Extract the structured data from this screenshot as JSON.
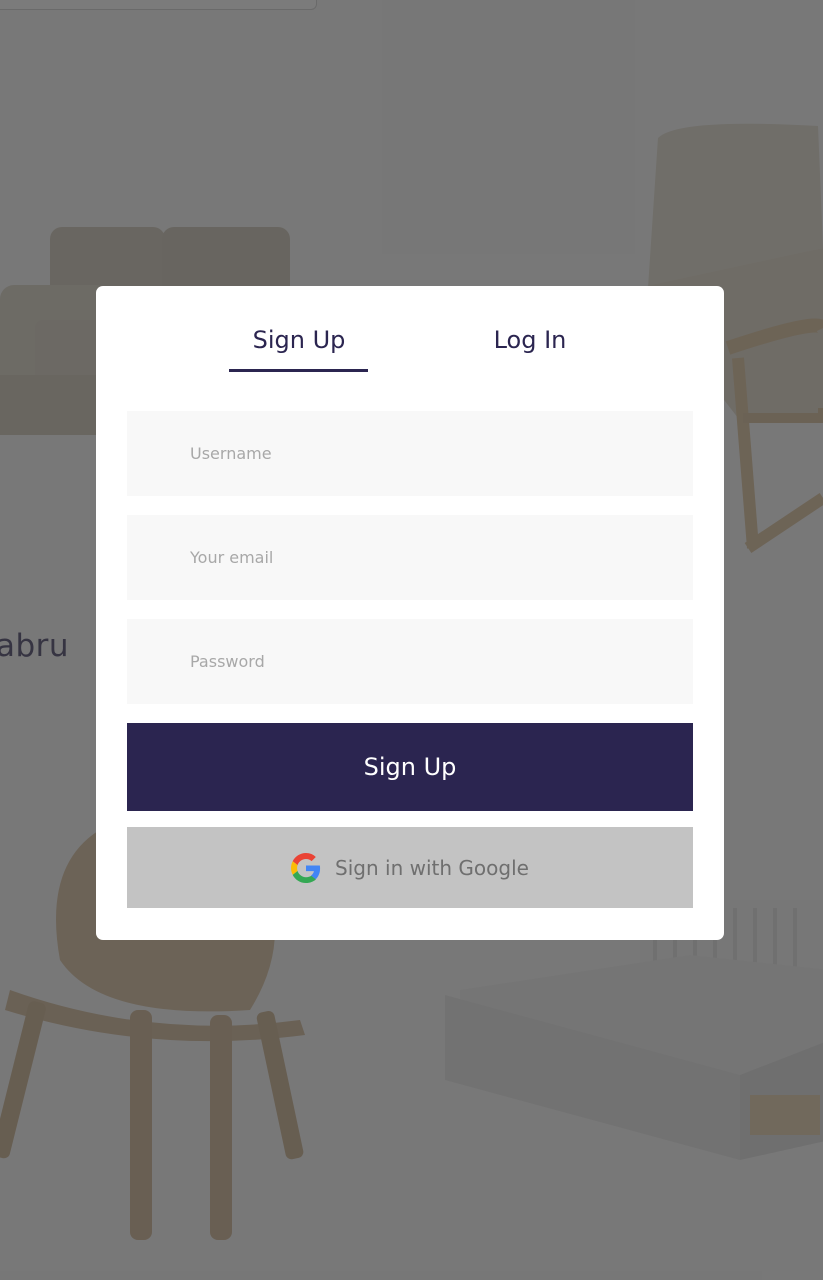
{
  "background": {
    "partial_text": "abru"
  },
  "tabs": {
    "signup_label": "Sign Up",
    "login_label": "Log In",
    "active": "Sign Up"
  },
  "form": {
    "username_placeholder": "Username",
    "email_placeholder": "Your email",
    "password_placeholder": "Password",
    "submit_label": "Sign Up",
    "google_label": "Sign in with Google"
  },
  "colors": {
    "accent": "#2b2550",
    "google_button_bg": "#c3c3c3",
    "field_bg": "#f8f8f8"
  },
  "icons": {
    "google": "google-icon"
  }
}
